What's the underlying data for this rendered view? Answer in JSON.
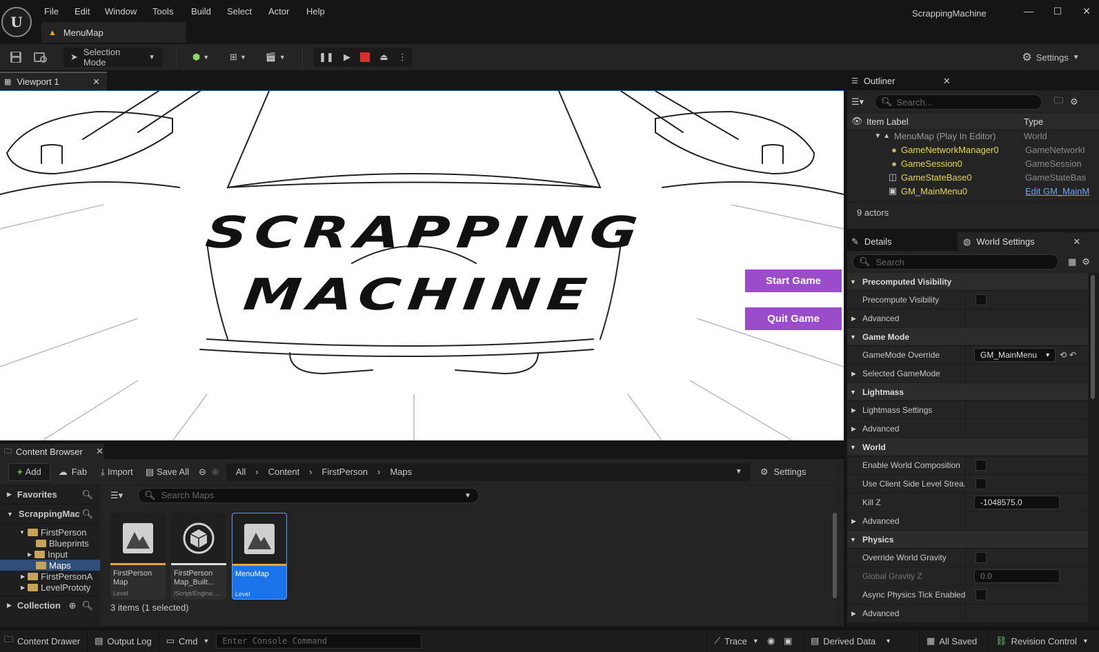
{
  "app": {
    "window_title": "ScrappingMachine",
    "menu": [
      "File",
      "Edit",
      "Window",
      "Tools",
      "Build",
      "Select",
      "Actor",
      "Help"
    ],
    "level_tab": "MenuMap"
  },
  "toolbar": {
    "selection_mode": "Selection Mode",
    "settings": "Settings"
  },
  "viewport": {
    "tab_label": "Viewport 1",
    "game_title_line1": "SCRAPPING",
    "game_title_line2": "MACHINE",
    "start_button": "Start Game",
    "quit_button": "Quit Game"
  },
  "outliner": {
    "tab_label": "Outliner",
    "search_placeholder": "Search...",
    "col_label": "Item Label",
    "col_type": "Type",
    "root": {
      "name": "MenuMap (Play In Editor)",
      "type": "World"
    },
    "rows": [
      {
        "name": "GameNetworkManager0",
        "type": "GameNetworkI"
      },
      {
        "name": "GameSession0",
        "type": "GameSession"
      },
      {
        "name": "GameStateBase0",
        "type": "GameStateBas"
      },
      {
        "name": "GM_MainMenu0",
        "type": "Edit GM_MainM"
      }
    ],
    "actor_count": "9 actors"
  },
  "details": {
    "tab_details": "Details",
    "tab_world_settings": "World Settings",
    "search_placeholder": "Search",
    "sections": {
      "precomputed_visibility": "Precomputed Visibility",
      "precompute_visibility": "Precompute Visibility",
      "advanced": "Advanced",
      "game_mode": "Game Mode",
      "gamemode_override": "GameMode Override",
      "gamemode_value": "GM_MainMenu",
      "selected_gamemode": "Selected GameMode",
      "lightmass": "Lightmass",
      "lightmass_settings": "Lightmass Settings",
      "world": "World",
      "enable_world_composition": "Enable World Composition",
      "use_client_side": "Use Client Side Level Strea...",
      "kill_z": "Kill Z",
      "kill_z_value": "-1048575.0",
      "physics": "Physics",
      "override_world_gravity": "Override World Gravity",
      "global_gravity_z": "Global Gravity Z",
      "global_gravity_value": "0.0",
      "async_physics": "Async Physics Tick Enabled"
    }
  },
  "content_browser": {
    "tab_label": "Content Browser",
    "add": "Add",
    "fab": "Fab",
    "import": "Import",
    "save_all": "Save All",
    "path": [
      "All",
      "Content",
      "FirstPerson",
      "Maps"
    ],
    "settings": "Settings",
    "favorites": "Favorites",
    "project": "ScrappingMac",
    "tree": [
      "FirstPerson",
      "Blueprints",
      "Input",
      "Maps",
      "FirstPersonA",
      "LevelPrototy"
    ],
    "collection": "Collection",
    "search_placeholder": "Search Maps",
    "assets": [
      {
        "name": "FirstPerson Map",
        "kind": "Level"
      },
      {
        "name": "FirstPerson Map_Built...",
        "kind": "/Script/Engine...."
      },
      {
        "name": "MenuMap",
        "kind": "Level"
      }
    ],
    "item_count": "3 items (1 selected)"
  },
  "statusbar": {
    "content_drawer": "Content Drawer",
    "output_log": "Output Log",
    "cmd": "Cmd",
    "console_placeholder": "Enter Console Command",
    "trace": "Trace",
    "derived_data": "Derived Data",
    "all_saved": "All Saved",
    "revision_control": "Revision Control"
  },
  "colors": {
    "accent_purple": "#9b4cc9",
    "selection_blue": "#1a73e8",
    "level_orange": "#e8a53c",
    "actor_yellow": "#e6d55a"
  }
}
